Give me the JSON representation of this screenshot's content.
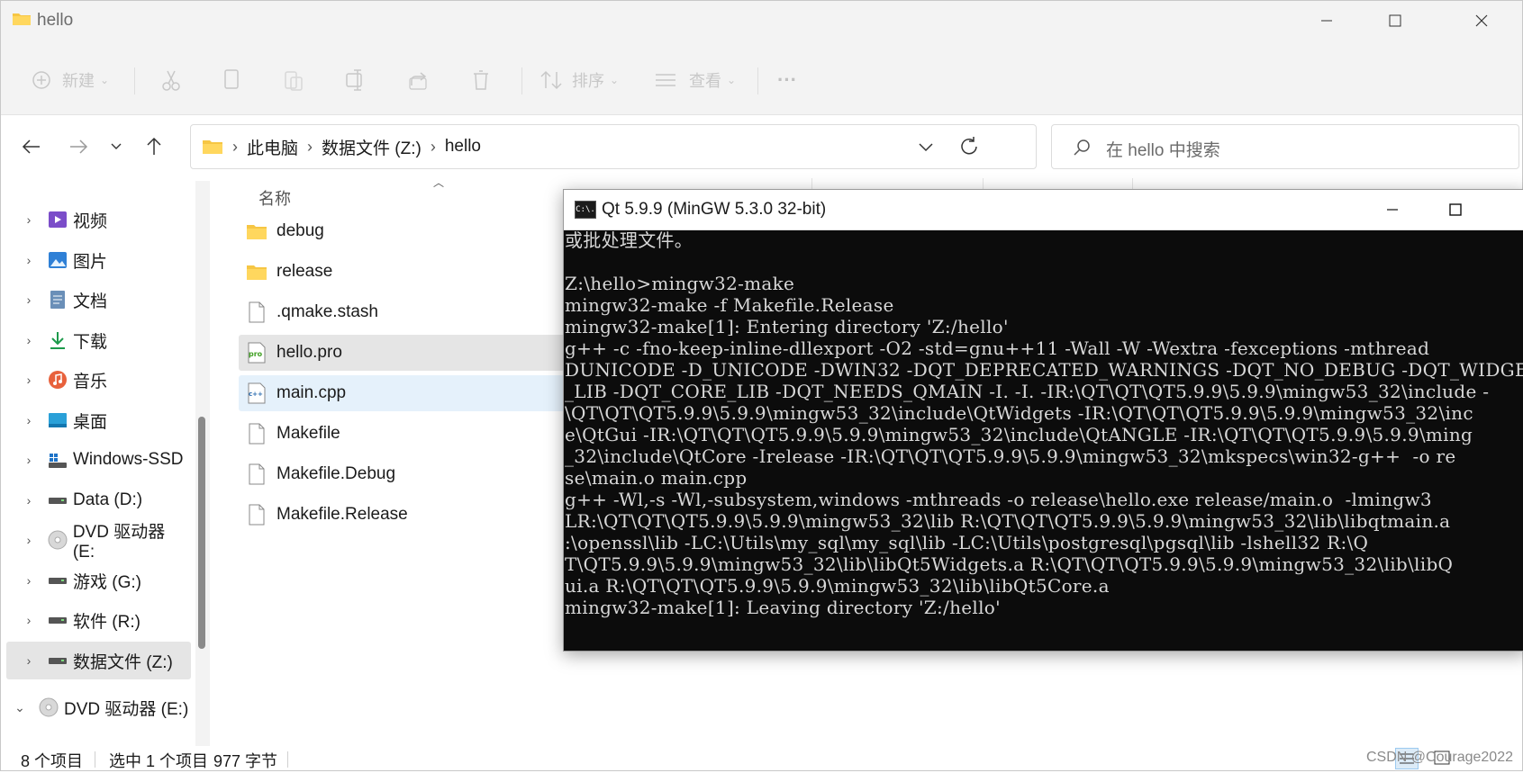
{
  "window": {
    "title": "hello"
  },
  "ribbon": {
    "new_label": "新建",
    "sort_label": "排序",
    "view_label": "查看",
    "more_label": "···"
  },
  "address": {
    "crumbs": [
      "此电脑",
      "数据文件 (Z:)",
      "hello"
    ]
  },
  "search": {
    "placeholder": "在 hello 中搜索"
  },
  "sidebar": {
    "items": [
      {
        "label": "视频",
        "icon": "video-icon"
      },
      {
        "label": "图片",
        "icon": "pictures-icon"
      },
      {
        "label": "文档",
        "icon": "documents-icon"
      },
      {
        "label": "下载",
        "icon": "download-icon"
      },
      {
        "label": "音乐",
        "icon": "music-icon"
      },
      {
        "label": "桌面",
        "icon": "desktop-icon"
      },
      {
        "label": "Windows-SSD",
        "icon": "drive-icon"
      },
      {
        "label": "Data (D:)",
        "icon": "drive-icon"
      },
      {
        "label": "DVD 驱动器 (E:",
        "icon": "dvd-icon"
      },
      {
        "label": "游戏 (G:)",
        "icon": "drive-icon"
      },
      {
        "label": "软件 (R:)",
        "icon": "drive-icon"
      },
      {
        "label": "数据文件 (Z:)",
        "icon": "drive-icon"
      },
      {
        "label": "DVD 驱动器 (E:)",
        "icon": "dvd-icon"
      }
    ]
  },
  "files": {
    "column_name": "名称",
    "rows": [
      {
        "name": "debug",
        "icon": "folder-icon"
      },
      {
        "name": "release",
        "icon": "folder-icon"
      },
      {
        "name": ".qmake.stash",
        "icon": "file-icon"
      },
      {
        "name": "hello.pro",
        "icon": "pro-file-icon"
      },
      {
        "name": "main.cpp",
        "icon": "cpp-file-icon"
      },
      {
        "name": "Makefile",
        "icon": "file-icon"
      },
      {
        "name": "Makefile.Debug",
        "icon": "file-icon"
      },
      {
        "name": "Makefile.Release",
        "icon": "file-icon"
      }
    ]
  },
  "status": {
    "count": "8 个项目",
    "selection": "选中 1 个项目",
    "size": "977 字节"
  },
  "watermark": "CSDN @Courage2022",
  "console": {
    "title": "Qt 5.9.9 (MinGW 5.3.0 32-bit)",
    "icon_text": "C:\\.",
    "lines": [
      "或批处理文件。",
      "",
      "Z:\\hello>mingw32-make",
      "mingw32-make -f Makefile.Release",
      "mingw32-make[1]: Entering directory 'Z:/hello'",
      "g++ -c -fno-keep-inline-dllexport -O2 -std=gnu++11 -Wall -W -Wextra -fexceptions -mthread",
      "DUNICODE -D_UNICODE -DWIN32 -DQT_DEPRECATED_WARNINGS -DQT_NO_DEBUG -DQT_WIDGETS_LIB -DQT_",
      "_LIB -DQT_CORE_LIB -DQT_NEEDS_QMAIN -I. -I. -IR:\\QT\\QT\\QT5.9.9\\5.9.9\\mingw53_32\\include -",
      "\\QT\\QT\\QT5.9.9\\5.9.9\\mingw53_32\\include\\QtWidgets -IR:\\QT\\QT\\QT5.9.9\\5.9.9\\mingw53_32\\inc",
      "e\\QtGui -IR:\\QT\\QT\\QT5.9.9\\5.9.9\\mingw53_32\\include\\QtANGLE -IR:\\QT\\QT\\QT5.9.9\\5.9.9\\ming",
      "_32\\include\\QtCore -Irelease -IR:\\QT\\QT\\QT5.9.9\\5.9.9\\mingw53_32\\mkspecs\\win32-g++  -o re",
      "se\\main.o main.cpp",
      "g++ -Wl,-s -Wl,-subsystem,windows -mthreads -o release\\hello.exe release/main.o  -lmingw3",
      "LR:\\QT\\QT\\QT5.9.9\\5.9.9\\mingw53_32\\lib R:\\QT\\QT\\QT5.9.9\\5.9.9\\mingw53_32\\lib\\libqtmain.a",
      ":\\openssl\\lib -LC:\\Utils\\my_sql\\my_sql\\lib -LC:\\Utils\\postgresql\\pgsql\\lib -lshell32 R:\\Q",
      "T\\QT5.9.9\\5.9.9\\mingw53_32\\lib\\libQt5Widgets.a R:\\QT\\QT\\QT5.9.9\\5.9.9\\mingw53_32\\lib\\libQ",
      "ui.a R:\\QT\\QT\\QT5.9.9\\5.9.9\\mingw53_32\\lib\\libQt5Core.a",
      "mingw32-make[1]: Leaving directory 'Z:/hello'"
    ]
  }
}
